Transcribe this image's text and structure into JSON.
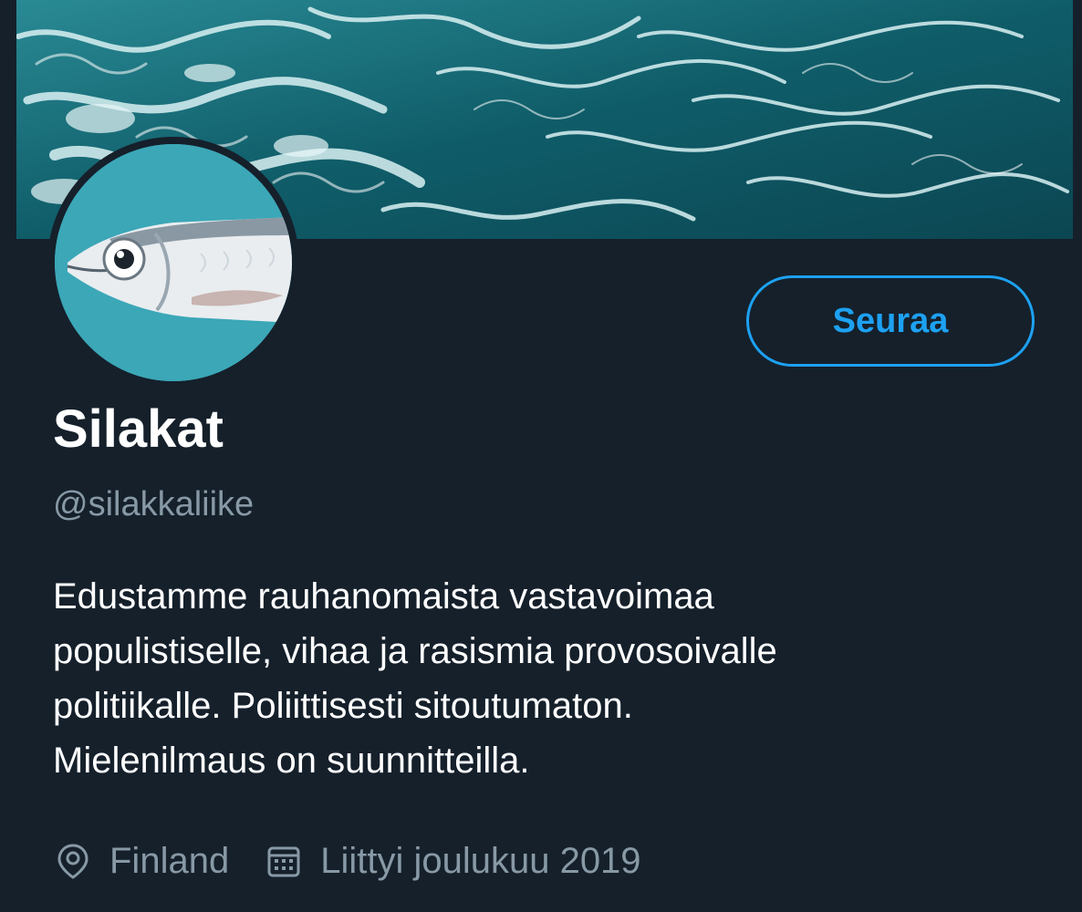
{
  "profile": {
    "display_name": "Silakat",
    "handle": "@silakkaliike",
    "bio_lines": [
      "Edustamme rauhanomaista vastavoimaa",
      "populistiselle, vihaa ja rasismia provosoivalle",
      "politiikalle. Poliittisesti sitoutumaton.",
      "Mielenilmaus on suunnitteilla."
    ],
    "location": "Finland",
    "joined": "Liittyi joulukuu 2019",
    "location_icon": "location-pin-icon",
    "joined_icon": "calendar-icon",
    "avatar_description_icon": "fish-avatar"
  },
  "actions": {
    "follow_label": "Seuraa"
  },
  "colors": {
    "background": "#15202b",
    "accent": "#1da1f2",
    "secondary_text": "#8899a6",
    "primary_text": "#ffffff",
    "banner_water": "#0f5a66",
    "avatar_bg": "#3ba7b7"
  }
}
